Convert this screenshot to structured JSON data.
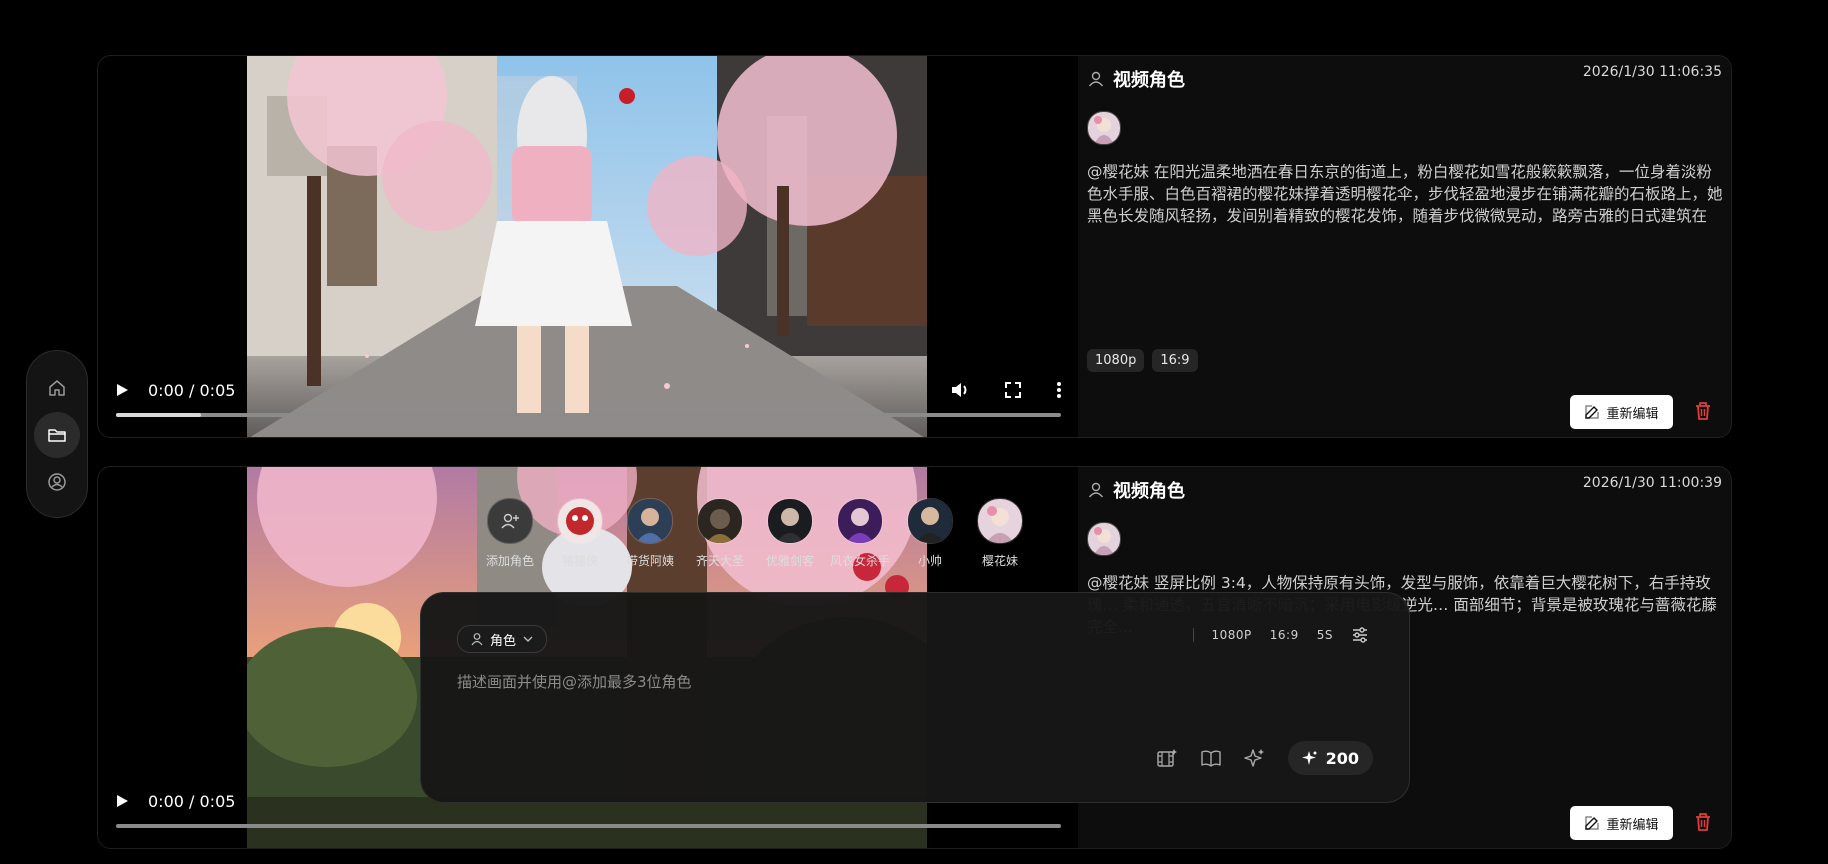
{
  "sidebar": {
    "items": [
      {
        "icon": "home-icon",
        "active": false
      },
      {
        "icon": "folder-icon",
        "active": true
      },
      {
        "icon": "user-circle-icon",
        "active": false
      }
    ]
  },
  "cards": [
    {
      "player": {
        "time": "0:00 / 0:05",
        "progress": 0.09
      },
      "title": "视频角色",
      "timestamp": "2026/1/30 11:06:35",
      "description": "@樱花妹 在阳光温柔地洒在春日东京的街道上，粉白樱花如雪花般簌簌飘落，一位身着淡粉色水手服、白色百褶裙的樱花妹撑着透明樱花伞，步伐轻盈地漫步在铺满花瓣的石板路上，她黑色长发随风轻扬，发间别着精致的樱花发饰，随着步伐微微晃动，路旁古雅的日式建筑在樱...",
      "tags": [
        "1080p",
        "16:9"
      ],
      "edit_label": "重新编辑"
    },
    {
      "player": {
        "time": "0:00 / 0:05",
        "progress": 0.0
      },
      "title": "视频角色",
      "timestamp": "2026/1/30 11:00:39",
      "description": "@樱花妹 竖屏比例 3:4，人物保持原有头饰，发型与服饰，依靠着巨大樱花树下，右手持玫瑰… 柔和通透，五官清晰不暗沉；采用电影级逆光… 面部细节；背景是被玫瑰花与蔷薇花藤完全...",
      "tags": [],
      "edit_label": "重新编辑"
    }
  ],
  "characters": [
    {
      "label": "添加角色",
      "type": "add"
    },
    {
      "label": "猪猪侠",
      "color": "#c0282c"
    },
    {
      "label": "带货阿姨",
      "color": "#7a6a58"
    },
    {
      "label": "齐天大圣",
      "color": "#5b5046"
    },
    {
      "label": "优雅剑客",
      "color": "#33363c"
    },
    {
      "label": "风衣女杀手",
      "color": "#5a2b86"
    },
    {
      "label": "小帅",
      "color": "#2e3c52"
    },
    {
      "label": "樱花妹",
      "color": "#d9b8c8"
    }
  ],
  "composer": {
    "role_label": "角色",
    "resolution": "1080P",
    "ratio": "16:9",
    "duration": "5S",
    "placeholder": "描述画面并使用@添加最多3位角色",
    "credits": "200"
  }
}
